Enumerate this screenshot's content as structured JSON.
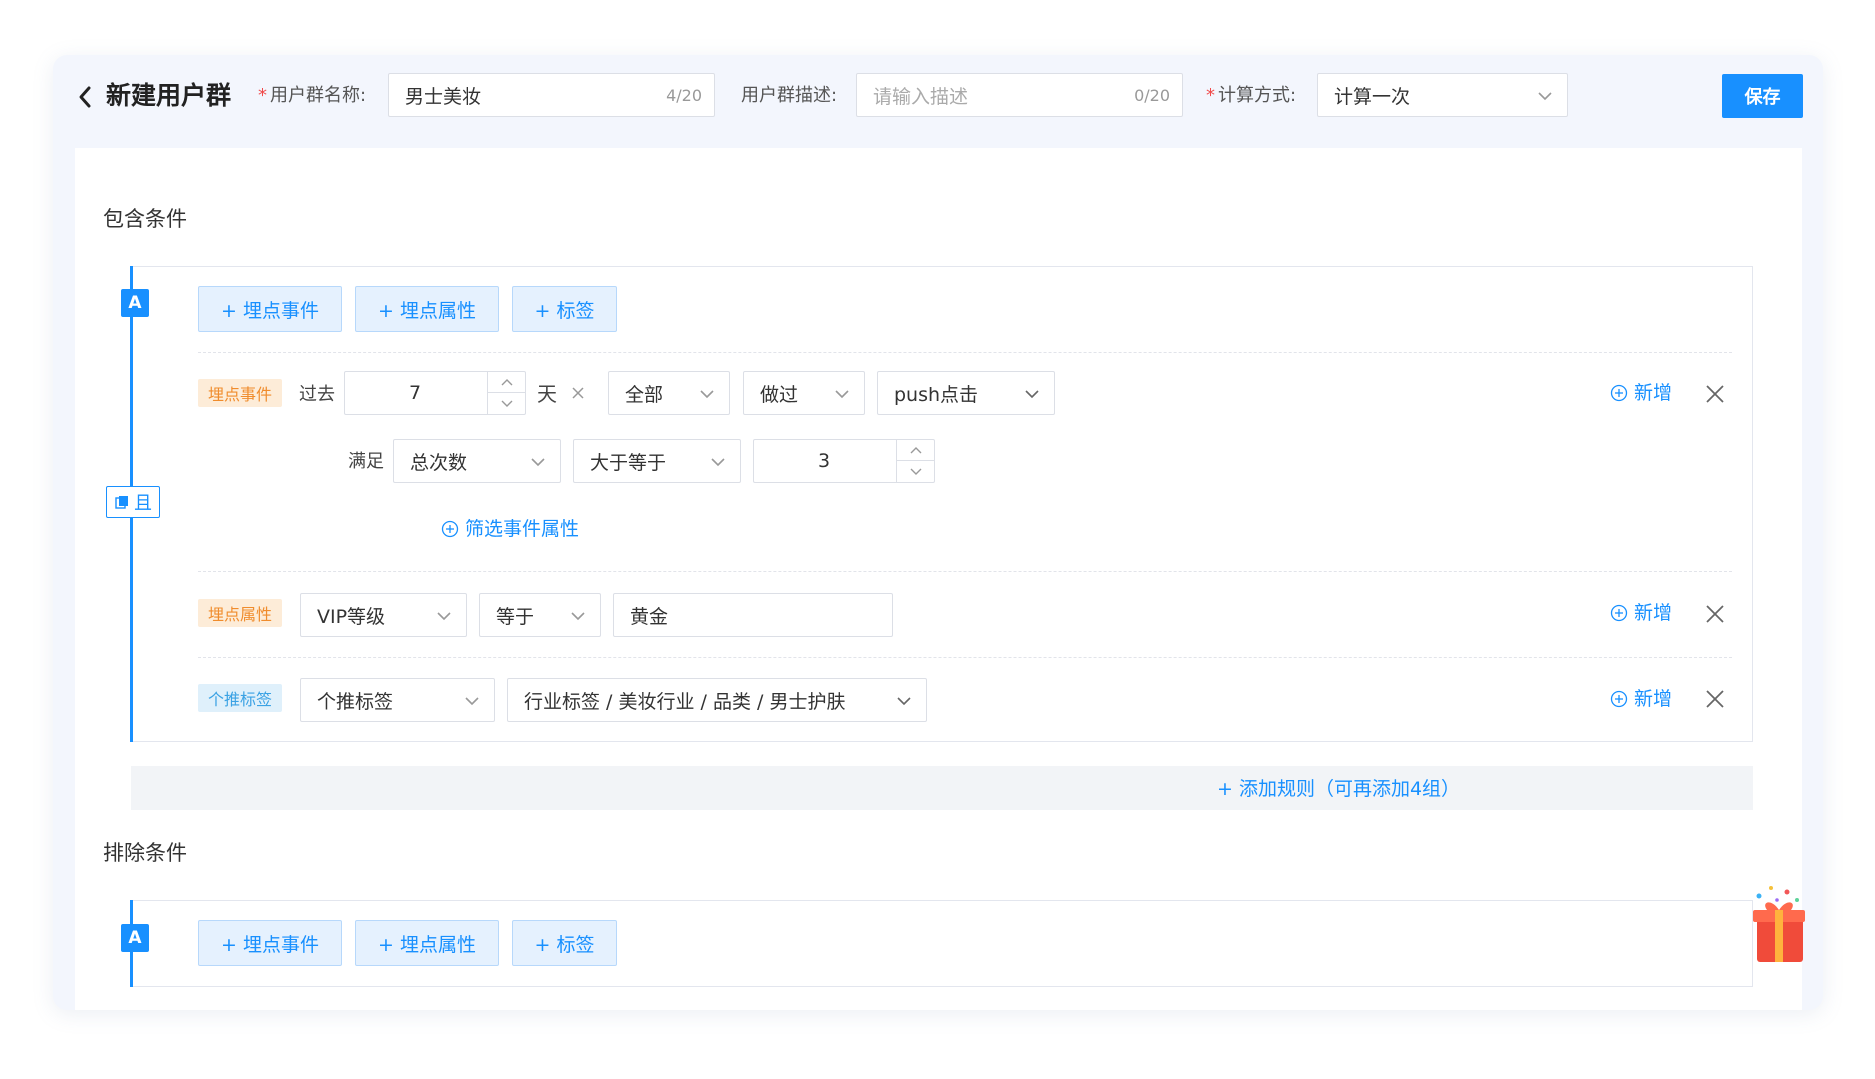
{
  "header": {
    "title": "新建用户群",
    "name_label": "用户群名称:",
    "name_value": "男士美妆",
    "name_counter": "4/20",
    "desc_label": "用户群描述:",
    "desc_placeholder": "请输入描述",
    "desc_counter": "0/20",
    "calc_label": "计算方式:",
    "calc_value": "计算一次",
    "save_label": "保存",
    "required_mark": "*"
  },
  "include": {
    "title": "包含条件",
    "group_badge": "A",
    "and_label": "且",
    "add_buttons": [
      "+ 埋点事件",
      "+ 埋点属性",
      "+ 标签"
    ],
    "event_rule": {
      "tag": "埋点事件",
      "past_label": "过去",
      "days_value": "7",
      "days_unit": "天",
      "scope": "全部",
      "action": "做过",
      "event": "push点击",
      "meet_label": "满足",
      "metric": "总次数",
      "operator": "大于等于",
      "threshold": "3",
      "filter_link": "筛选事件属性",
      "add_link": "新增"
    },
    "attr_rule": {
      "tag": "埋点属性",
      "field": "VIP等级",
      "operator": "等于",
      "value": "黄金",
      "add_link": "新增"
    },
    "tag_rule": {
      "tag": "个推标签",
      "source": "个推标签",
      "path": "行业标签 / 美妆行业 / 品类 / 男士护肤",
      "add_link": "新增"
    },
    "add_rule": "+ 添加规则（可再添加4组）"
  },
  "exclude": {
    "title": "排除条件",
    "group_badge": "A",
    "add_buttons": [
      "+ 埋点事件",
      "+ 埋点属性",
      "+ 标签"
    ]
  },
  "colors": {
    "primary": "#1890ff",
    "event_tag": "#f08c2c",
    "push_tag": "#3ba2e4"
  },
  "icons": [
    "back-icon",
    "chevron-down-icon",
    "close-icon",
    "plus-circle-icon",
    "copy-icon",
    "gift-icon"
  ]
}
